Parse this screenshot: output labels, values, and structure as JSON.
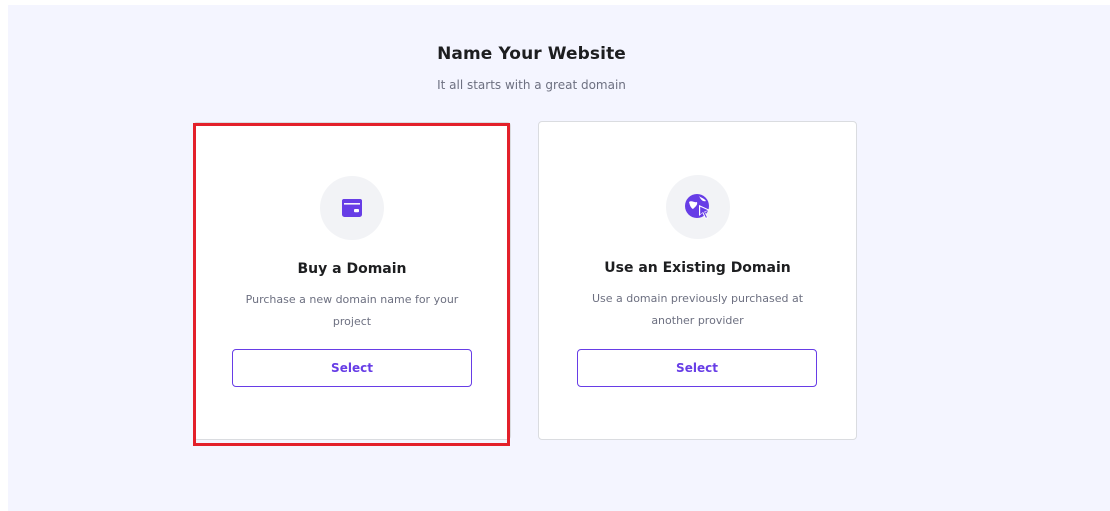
{
  "header": {
    "title": "Name Your Website",
    "subtitle": "It all starts with a great domain"
  },
  "options": [
    {
      "title": "Buy a Domain",
      "description": "Purchase a new domain name for your project",
      "button_label": "Select",
      "icon": "wallet-icon",
      "highlighted": true
    },
    {
      "title": "Use an Existing Domain",
      "description": "Use a domain previously purchased at another provider",
      "button_label": "Select",
      "icon": "globe-cursor-icon",
      "highlighted": false
    }
  ],
  "colors": {
    "accent": "#673de6",
    "highlight_border": "#e3202a",
    "panel_background": "#f4f5ff"
  }
}
